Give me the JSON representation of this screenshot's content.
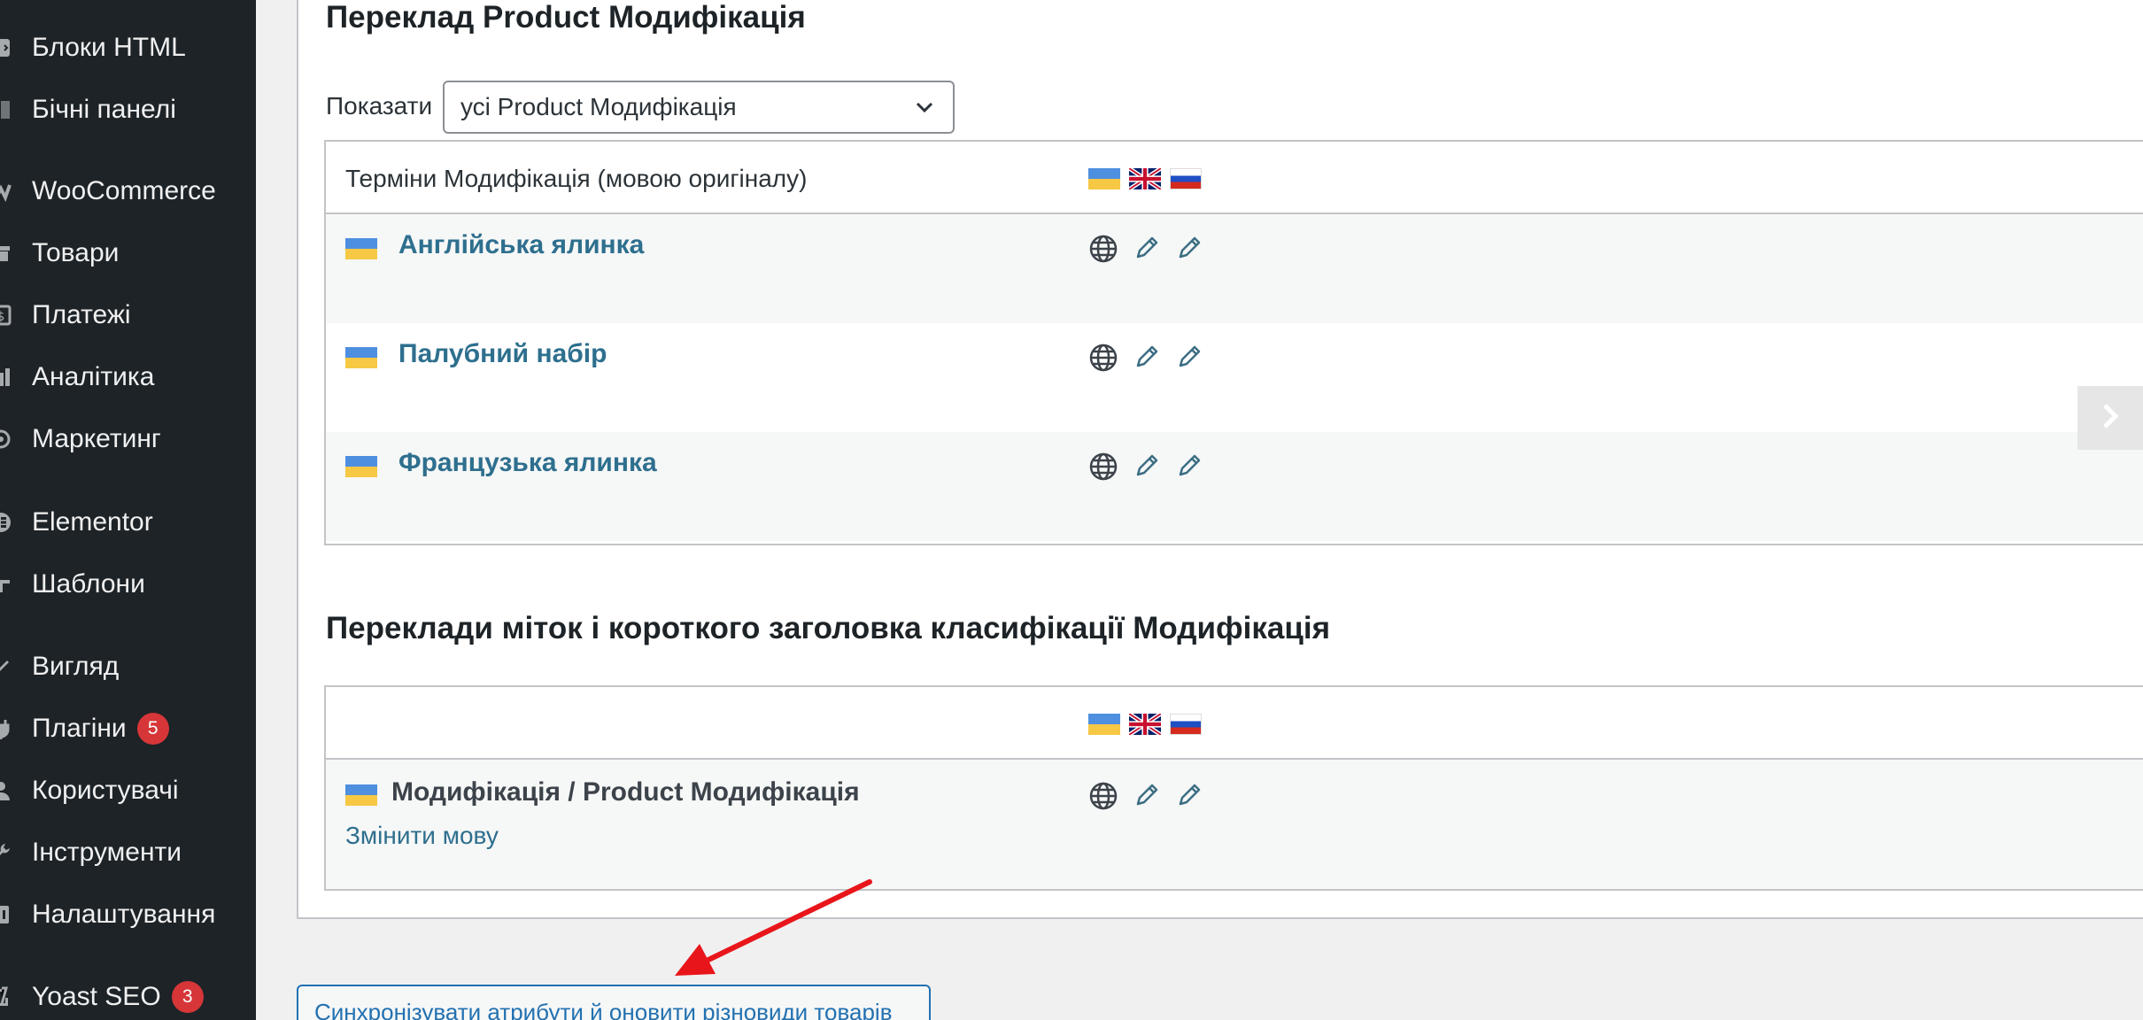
{
  "sidebar": {
    "items": [
      {
        "label": "Блоки HTML",
        "icon": "html-blocks-icon",
        "badge": null
      },
      {
        "label": "Бічні панелі",
        "icon": "sidebars-icon",
        "badge": null
      },
      {
        "label": "WooCommerce",
        "icon": "woocommerce-icon",
        "badge": null
      },
      {
        "label": "Товари",
        "icon": "products-icon",
        "badge": null
      },
      {
        "label": "Платежі",
        "icon": "payments-icon",
        "badge": null
      },
      {
        "label": "Аналітика",
        "icon": "analytics-icon",
        "badge": null
      },
      {
        "label": "Маркетинг",
        "icon": "marketing-icon",
        "badge": null
      },
      {
        "label": "Elementor",
        "icon": "elementor-icon",
        "badge": null
      },
      {
        "label": "Шаблони",
        "icon": "templates-icon",
        "badge": null
      },
      {
        "label": "Вигляд",
        "icon": "appearance-icon",
        "badge": null
      },
      {
        "label": "Плагіни",
        "icon": "plugins-icon",
        "badge": "5"
      },
      {
        "label": "Користувачі",
        "icon": "users-icon",
        "badge": null
      },
      {
        "label": "Інструменти",
        "icon": "tools-icon",
        "badge": null
      },
      {
        "label": "Налаштування",
        "icon": "settings-icon",
        "badge": null
      },
      {
        "label": "Yoast SEO",
        "icon": "yoast-icon",
        "badge": "3"
      }
    ]
  },
  "terms_section": {
    "title": "Переклад Product Модифікація",
    "show_label": "Показати",
    "select_value": "усі Product Модифікація",
    "table_header": "Терміни Модифікація (мовою оригіналу)",
    "rows": [
      {
        "term": "Англійська ялинка"
      },
      {
        "term": "Палубний набір"
      },
      {
        "term": "Французька ялинка"
      }
    ]
  },
  "labels_section": {
    "title": "Переклади міток і короткого заголовка класифікації Модифікація",
    "row_label": "Модифікація / Product Модифікація",
    "change_language": "Змінити мову"
  },
  "sync_button": "Синхронізувати атрибути й оновити різновиди товарів",
  "colors": {
    "sidebar_bg": "#1d2327",
    "link": "#2e6f8e",
    "badge": "#d63638",
    "annotation_arrow": "#e8161b"
  }
}
